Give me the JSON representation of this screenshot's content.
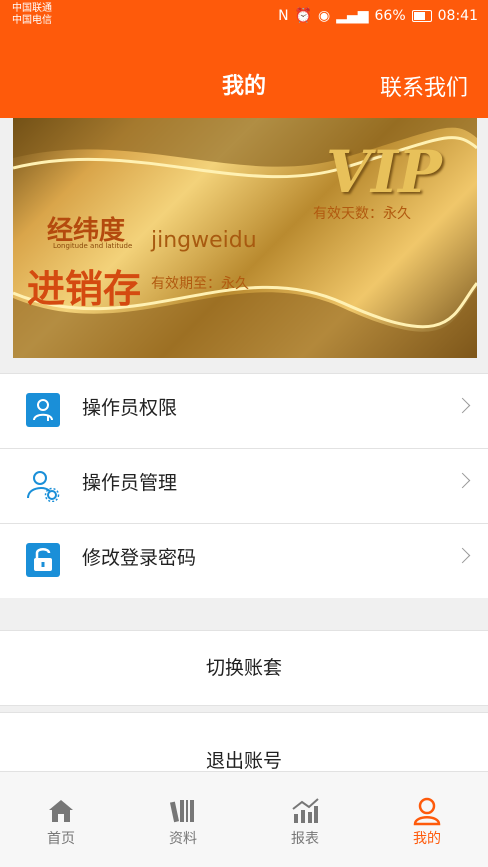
{
  "status": {
    "carrier1": "中国联通",
    "carrier2": "中国电信",
    "battery": "66%",
    "time": "08:41"
  },
  "header": {
    "title": "我的",
    "contact_label": "联系我们"
  },
  "card": {
    "vip_text": "VIP",
    "valid_days": "有效天数：永久",
    "logo_top": "经纬度",
    "logo_en": "Longitude and latitude",
    "logo_bottom": "进销存",
    "username": "jingweidu",
    "expiry": "有效期至：永久"
  },
  "menu": {
    "items": [
      {
        "label": "操作员权限",
        "icon": "user-permission-icon"
      },
      {
        "label": "操作员管理",
        "icon": "user-settings-icon"
      },
      {
        "label": "修改登录密码",
        "icon": "lock-icon"
      }
    ]
  },
  "actions": {
    "switch_label": "切换账套",
    "logout_label": "退出账号"
  },
  "tabbar": {
    "tabs": [
      {
        "label": "首页",
        "icon": "home-icon"
      },
      {
        "label": "资料",
        "icon": "books-icon"
      },
      {
        "label": "报表",
        "icon": "chart-icon"
      },
      {
        "label": "我的",
        "icon": "person-icon"
      }
    ],
    "active_index": 3
  },
  "colors": {
    "primary": "#fe5a0b",
    "icon_blue": "#1a8fd8"
  }
}
